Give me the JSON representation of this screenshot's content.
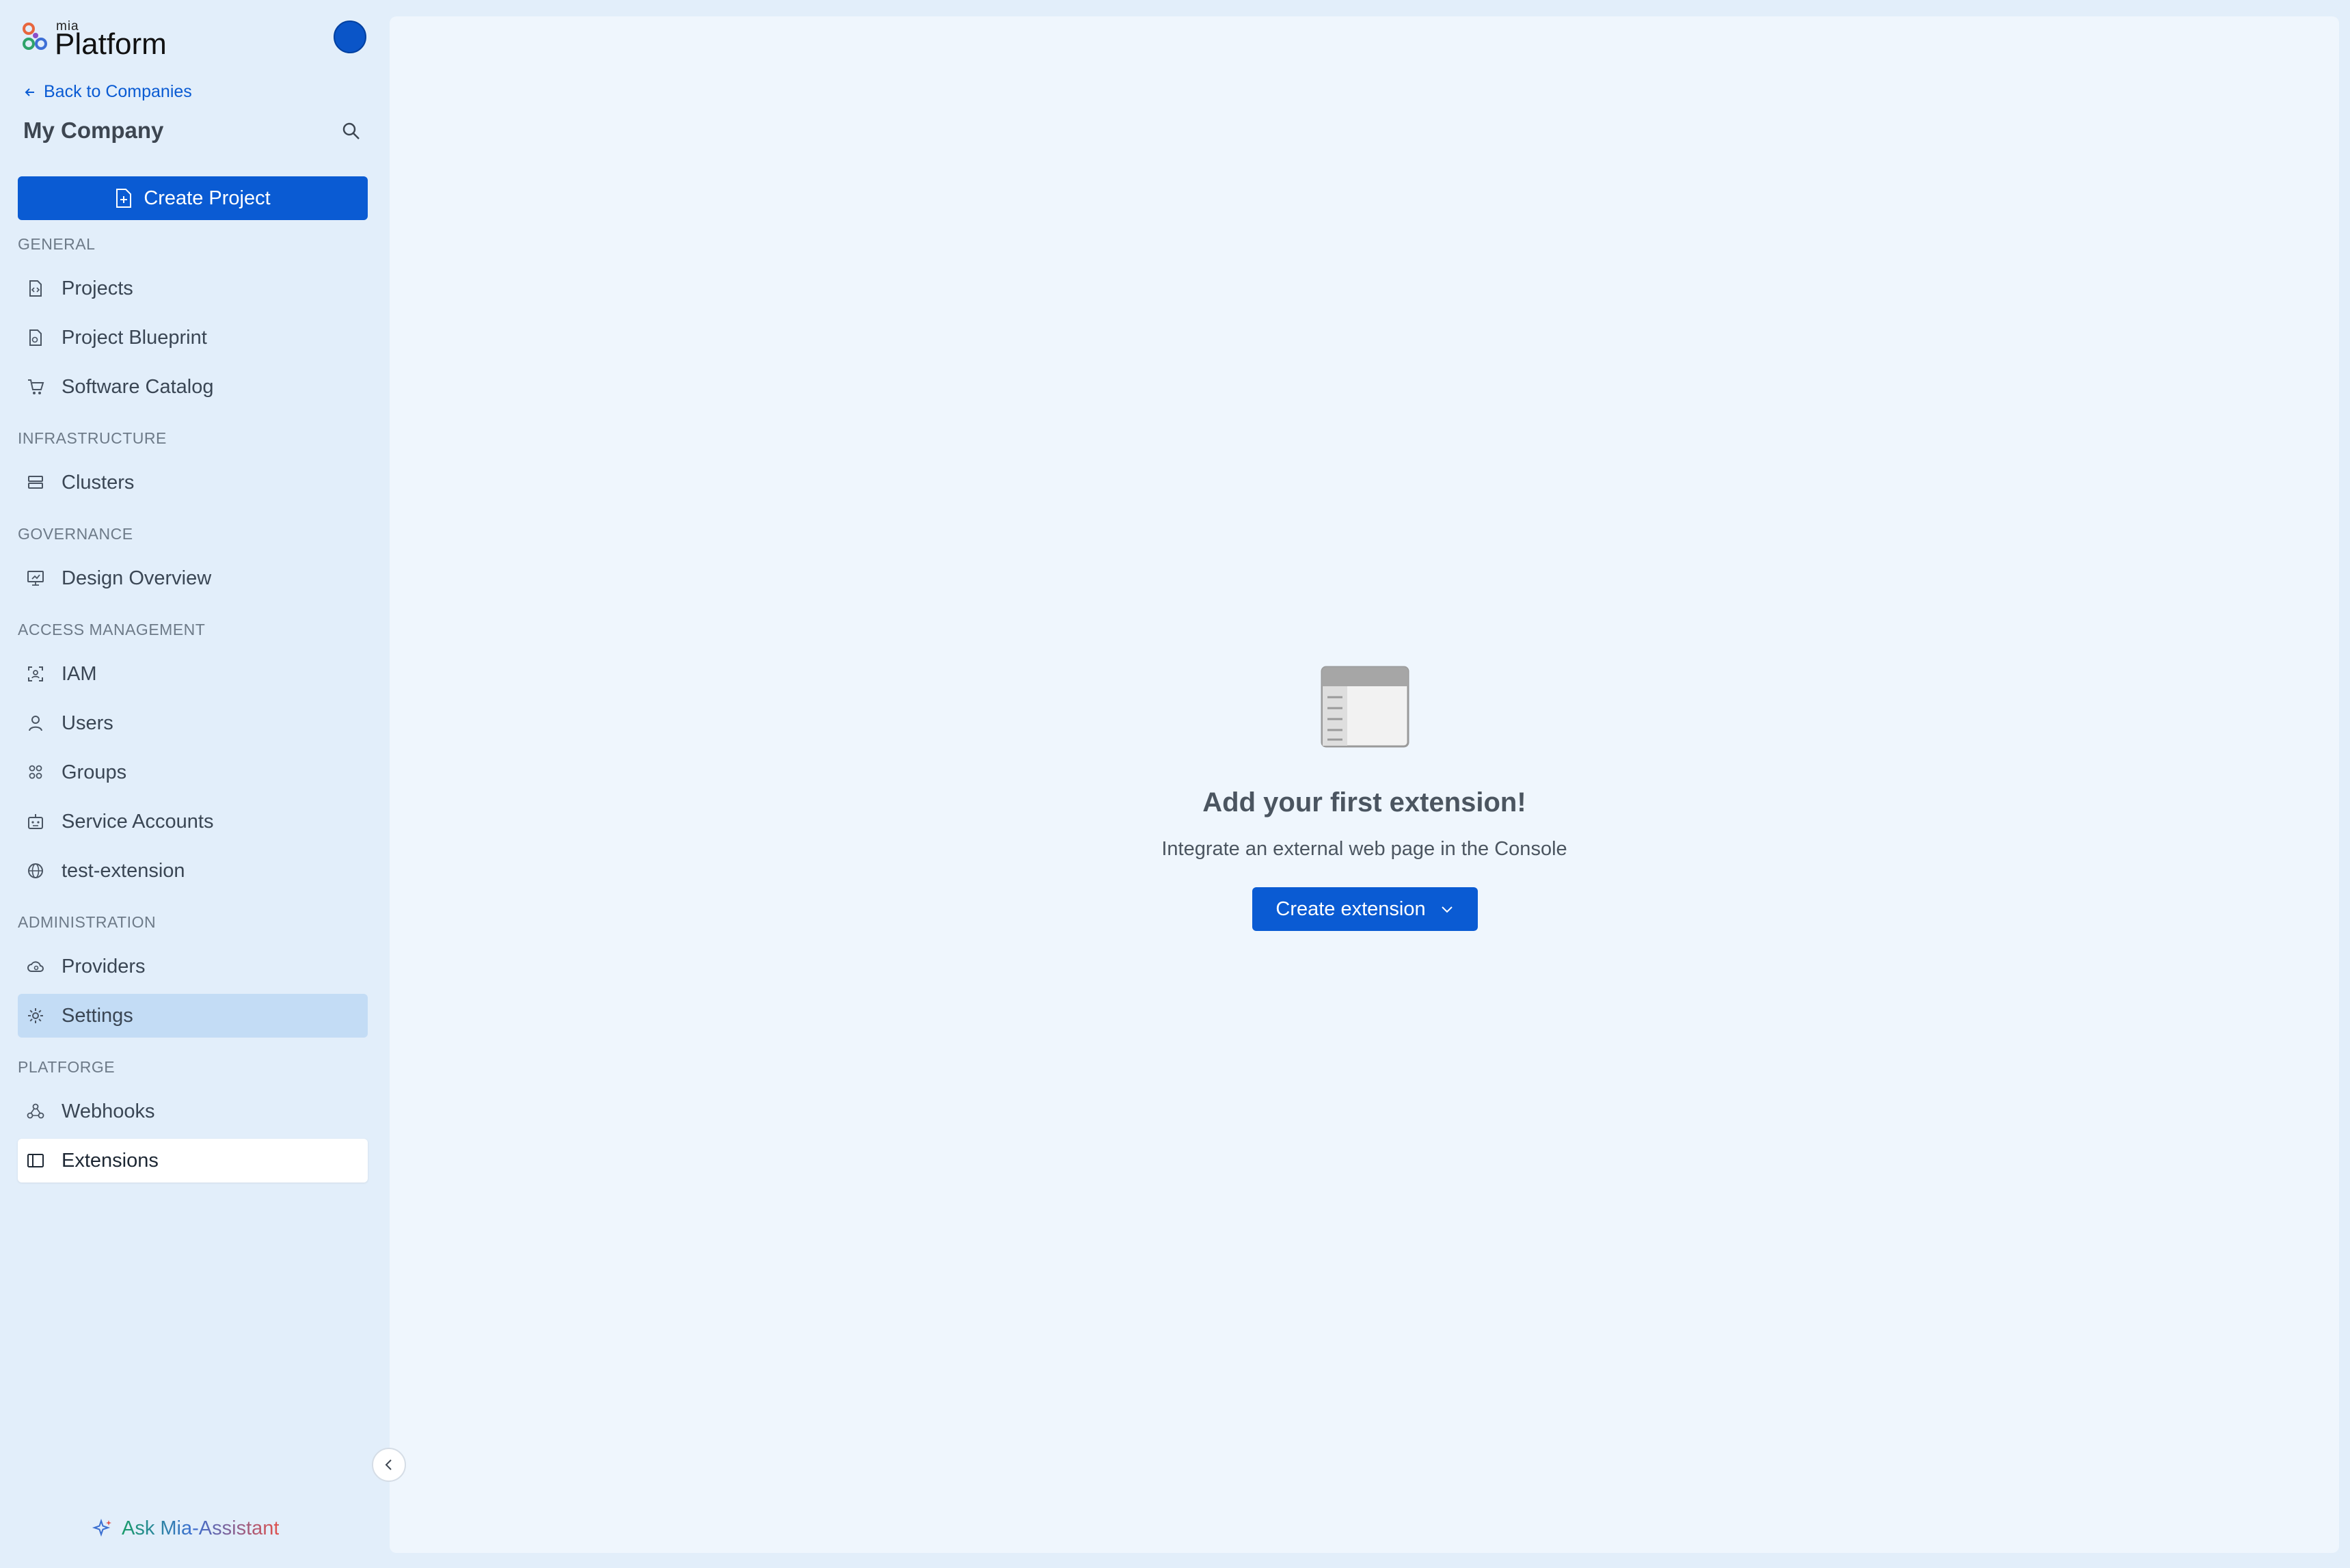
{
  "app": {
    "logo_small": "mia",
    "logo_big": "Platform"
  },
  "sidebar": {
    "back_label": "Back to Companies",
    "company_name": "My Company",
    "create_project_label": "Create Project",
    "sections": {
      "general": "GENERAL",
      "infrastructure": "INFRASTRUCTURE",
      "governance": "GOVERNANCE",
      "access": "ACCESS MANAGEMENT",
      "administration": "ADMINISTRATION",
      "platforge": "PLATFORGE"
    },
    "items": {
      "projects": "Projects",
      "blueprint": "Project Blueprint",
      "catalog": "Software Catalog",
      "clusters": "Clusters",
      "design": "Design Overview",
      "iam": "IAM",
      "users": "Users",
      "groups": "Groups",
      "service_accounts": "Service Accounts",
      "test_extension": "test-extension",
      "providers": "Providers",
      "settings": "Settings",
      "webhooks": "Webhooks",
      "extensions": "Extensions"
    },
    "assistant_label": "Ask Mia-Assistant"
  },
  "main": {
    "empty_title": "Add your first extension!",
    "empty_subtitle": "Integrate an external web page in the Console",
    "create_extension_label": "Create extension"
  },
  "colors": {
    "accent": "#0a5bd3",
    "sidebar_bg": "#e2eefa",
    "content_bg": "#eff6fd",
    "selected_item": "#c3dcf5"
  }
}
